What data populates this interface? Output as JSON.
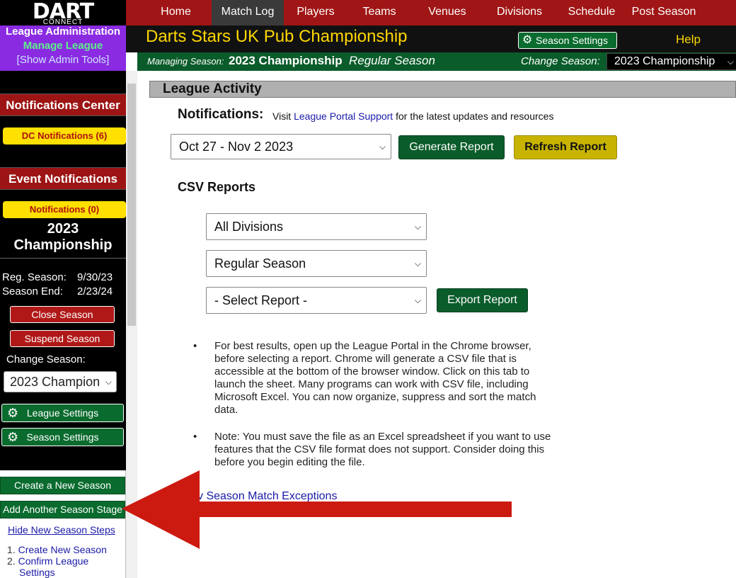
{
  "logo": {
    "big": "DART",
    "small": "CONNECT"
  },
  "admin": {
    "title": "League Administration",
    "manage": "Manage League",
    "tools": "[Show Admin Tools]"
  },
  "sidebar": {
    "notifications_center": "Notifications Center",
    "dc_notifications": "DC Notifications (6)",
    "event_notifications": "Event Notifications",
    "notifications": "Notifications (0)",
    "season_name_line1": "2023",
    "season_name_line2": "Championship",
    "reg_season_label": "Reg. Season:",
    "reg_season_date": "9/30/23",
    "season_end_label": "Season End:",
    "season_end_date": "2/23/24",
    "close_season": "Close Season",
    "suspend_season": "Suspend Season",
    "change_season_label": "Change Season:",
    "change_season_value": "2023 Champion",
    "league_settings": "League Settings",
    "season_settings": "Season Settings",
    "create_new_season": "Create a New Season",
    "add_stage": "Add Another Season Stage",
    "hide_steps": "Hide New Season Steps",
    "steps": [
      {
        "num": "1.",
        "label": "Create New Season"
      },
      {
        "num": "2.",
        "label": "Confirm League"
      },
      {
        "num": "",
        "label": "Settings"
      }
    ]
  },
  "nav": {
    "items": [
      {
        "label": "Home",
        "active": false
      },
      {
        "label": "Match Log",
        "active": true
      },
      {
        "label": "Players",
        "active": false
      },
      {
        "label": "Teams",
        "active": false
      },
      {
        "label": "Venues",
        "active": false
      },
      {
        "label": "Divisions",
        "active": false
      },
      {
        "label": "Schedule",
        "active": false
      },
      {
        "label": "Post Season",
        "active": false
      }
    ]
  },
  "header": {
    "title": "Darts Stars UK Pub Championship",
    "season_settings": "Season Settings",
    "help": "Help"
  },
  "managebar": {
    "label": "Managing Season:",
    "season": "2023 Championship",
    "stage": "Regular Season",
    "change_label": "Change Season:",
    "change_value": "2023 Championship"
  },
  "main": {
    "section_title": "League Activity",
    "notifications_label": "Notifications:",
    "notif_text_pre": "Visit ",
    "notif_link": "League Portal Support",
    "notif_text_post": " for the latest updates and resources",
    "date_range": "Oct 27 - Nov 2 2023",
    "generate_report": "Generate Report",
    "refresh_report": "Refresh Report",
    "csv_reports": "CSV Reports",
    "division_select": "All Divisions",
    "stage_select": "Regular Season",
    "report_select": "- Select Report -",
    "export_report": "Export Report",
    "bullet1": "For best results, open up the League Portal in the Chrome browser, before selecting a report. Chrome will generate a CSV file that is accessible at the bottom of the browser window. Click on this tab to launch the sheet. Many programs can work with CSV file, including Microsoft Excel. You can now organize, suppress and sort the match data.",
    "bullet2": "Note: You must save the file as an Excel spreadsheet if you want to use features that the CSV file format does not support. Consider doing this before you begin editing the file.",
    "exceptions_link": "v Season Match Exceptions"
  },
  "colors": {
    "nav_red": "#a01515",
    "title_yellow": "#ffd700",
    "green": "#0a5c2a",
    "annotation_arrow": "#cc1a10"
  }
}
